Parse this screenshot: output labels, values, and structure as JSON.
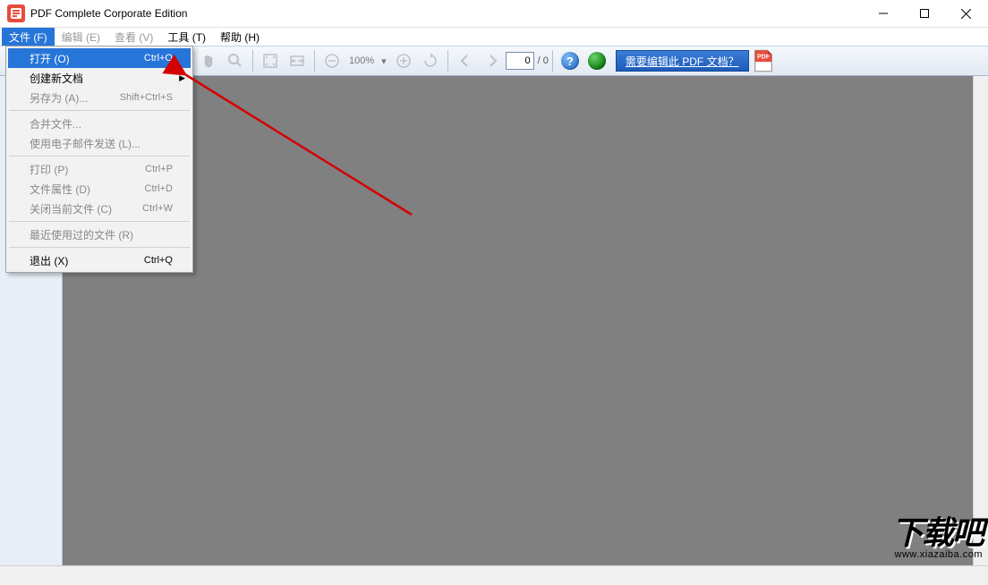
{
  "window": {
    "title": "PDF Complete Corporate Edition"
  },
  "menu": {
    "file": "文件 (F)",
    "edit": "编辑 (E)",
    "view": "查看 (V)",
    "tools": "工具 (T)",
    "help": "帮助 (H)"
  },
  "file_menu": {
    "open": {
      "label": "打开 (O)",
      "shortcut": "Ctrl+O"
    },
    "new_doc": {
      "label": "创建新文档"
    },
    "save_as": {
      "label": "另存为 (A)...",
      "shortcut": "Shift+Ctrl+S"
    },
    "merge": {
      "label": "合并文件..."
    },
    "email": {
      "label": "使用电子邮件发送 (L)..."
    },
    "print": {
      "label": "打印 (P)",
      "shortcut": "Ctrl+P"
    },
    "props": {
      "label": "文件属性 (D)",
      "shortcut": "Ctrl+D"
    },
    "close_file": {
      "label": "关闭当前文件 (C)",
      "shortcut": "Ctrl+W"
    },
    "recent": {
      "label": "最近使用过的文件 (R)"
    },
    "exit": {
      "label": "退出 (X)",
      "shortcut": "Ctrl+Q"
    }
  },
  "toolbar": {
    "zoom_level": "100%",
    "page_current": "0",
    "page_total": "/ 0",
    "edit_banner": "需要编辑此 PDF 文档？"
  },
  "watermark": {
    "logo": "下载吧",
    "url": "www.xiazaiba.com"
  }
}
